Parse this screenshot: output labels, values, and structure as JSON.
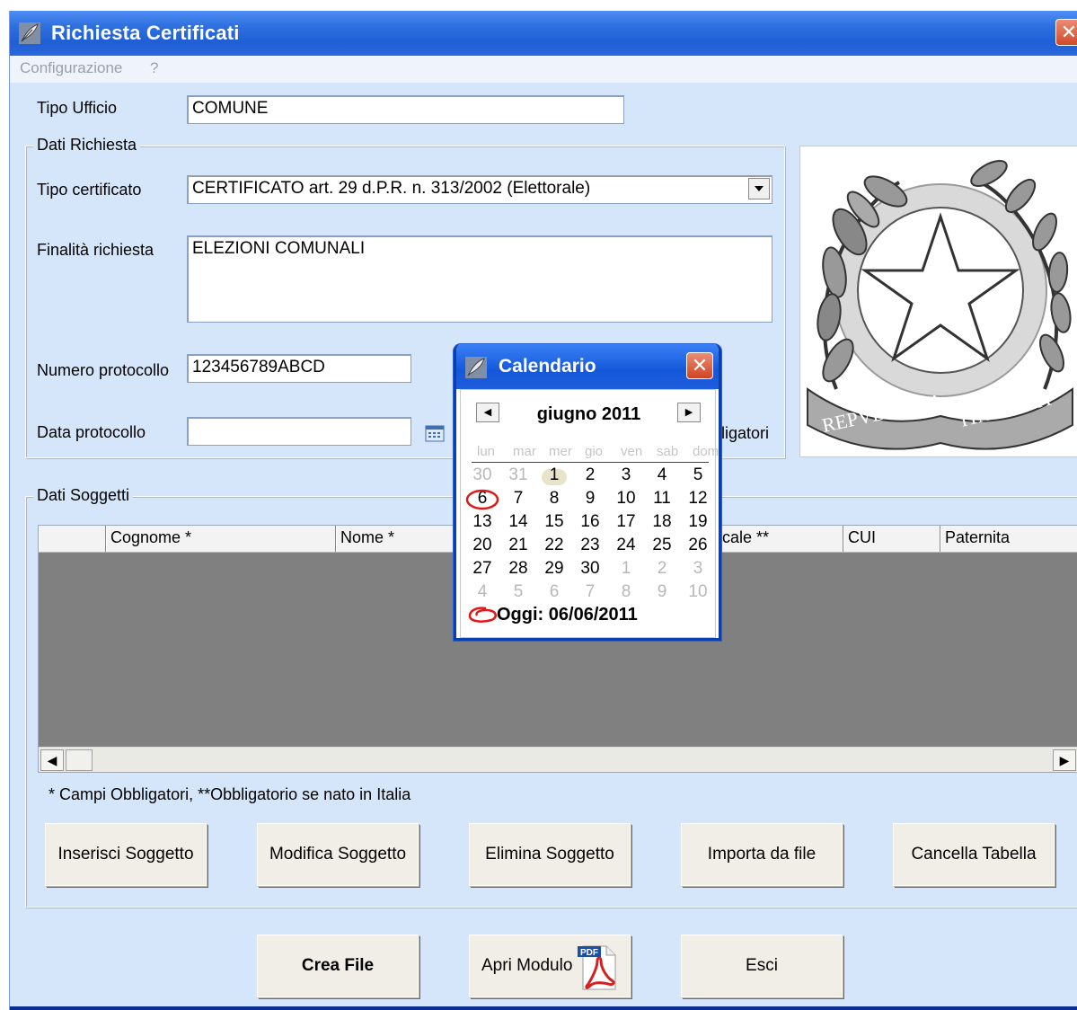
{
  "window": {
    "title": "Richiesta Certificati",
    "close_glyph": "✕"
  },
  "menu": {
    "items": [
      "Configurazione",
      "?"
    ]
  },
  "form": {
    "tipo_ufficio_label": "Tipo Ufficio",
    "tipo_ufficio_value": "COMUNE",
    "dati_richiesta_title": "Dati Richiesta",
    "tipo_certificato_label": "Tipo certificato",
    "tipo_certificato_value": "CERTIFICATO art. 29 d.P.R. n. 313/2002 (Elettorale)",
    "finalita_label": "Finalità richiesta",
    "finalita_value": "ELEZIONI COMUNALI",
    "numero_protocollo_label": "Numero protocollo",
    "numero_protocollo_value": "123456789ABCD",
    "data_protocollo_label": "Data protocollo",
    "data_protocollo_value": "",
    "obbligatori_partial": "ligatori"
  },
  "emblem": {
    "text_left": "REPVBBLICA",
    "text_right": "ITALIANA"
  },
  "soggetti": {
    "title": "Dati Soggetti",
    "columns": [
      "",
      "Cognome *",
      "Nome *",
      "",
      "cale **",
      "CUI",
      "Paternita"
    ],
    "note": "* Campi Obbligatori, **Obbligatorio se nato in Italia",
    "buttons": [
      "Inserisci Soggetto",
      "Modifica Soggetto",
      "Elimina Soggetto",
      "Importa da file",
      "Cancella Tabella"
    ]
  },
  "footer": {
    "crea_file": "Crea File",
    "apri_modulo": "Apri Modulo",
    "pdf_badge": "PDF",
    "esci": "Esci"
  },
  "calendar": {
    "title": "Calendario",
    "month": "giugno 2011",
    "weekdays": [
      "lun",
      "mar",
      "mer",
      "gio",
      "ven",
      "sab",
      "dom"
    ],
    "weeks": [
      [
        "30",
        "31",
        "1",
        "2",
        "3",
        "4",
        "5"
      ],
      [
        "6",
        "7",
        "8",
        "9",
        "10",
        "11",
        "12"
      ],
      [
        "13",
        "14",
        "15",
        "16",
        "17",
        "18",
        "19"
      ],
      [
        "20",
        "21",
        "22",
        "23",
        "24",
        "25",
        "26"
      ],
      [
        "27",
        "28",
        "29",
        "30",
        "1",
        "2",
        "3"
      ],
      [
        "4",
        "5",
        "6",
        "7",
        "8",
        "9",
        "10"
      ]
    ],
    "today_label": "Oggi: 06/06/2011"
  }
}
